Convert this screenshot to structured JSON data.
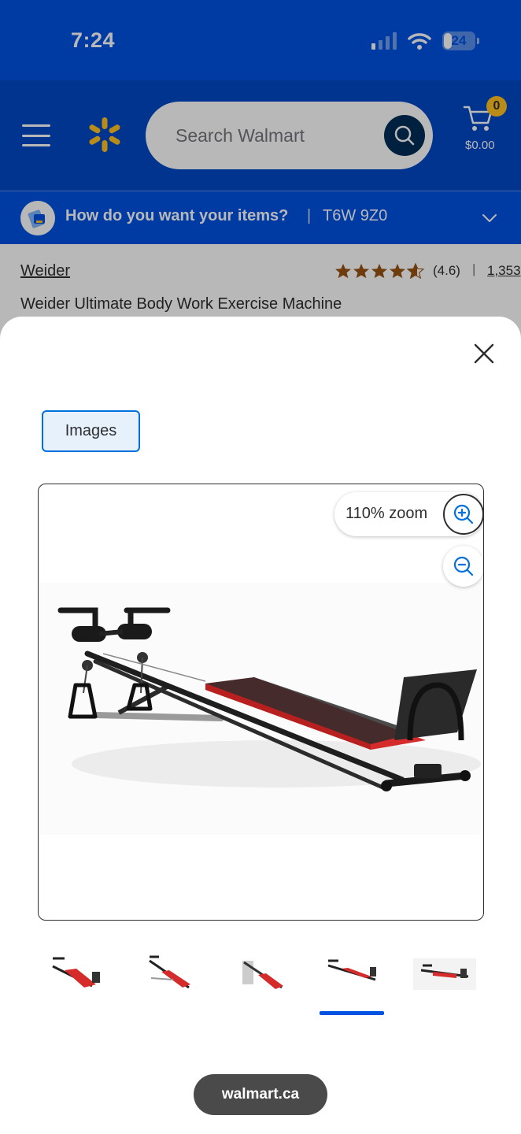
{
  "status_bar": {
    "time": "7:24",
    "battery": "24"
  },
  "header": {
    "search_placeholder": "Search Walmart",
    "cart_count": "0",
    "cart_total": "$0.00"
  },
  "delivery": {
    "prompt": "How do you want your items?",
    "separator": "|",
    "postal_code": "T6W 9Z0"
  },
  "product": {
    "brand": "Weider",
    "rating_value": "(4.6)",
    "rating_separator": "|",
    "review_count": "1,353",
    "title": "Weider Ultimate Body Work Exercise Machine",
    "stars_filled": 4.6
  },
  "modal": {
    "tab_label": "Images",
    "zoom_label": "110% zoom",
    "thumbnails": [
      "thumbnail-1",
      "thumbnail-2",
      "thumbnail-3",
      "thumbnail-4",
      "thumbnail-5"
    ],
    "selected_thumbnail": 4
  },
  "browser": {
    "url": "walmart.ca"
  },
  "colors": {
    "brand_blue": "#0053e2",
    "header_blue": "#0049c7",
    "spark_yellow": "#ffc220",
    "bench_red": "#d62b2b"
  }
}
